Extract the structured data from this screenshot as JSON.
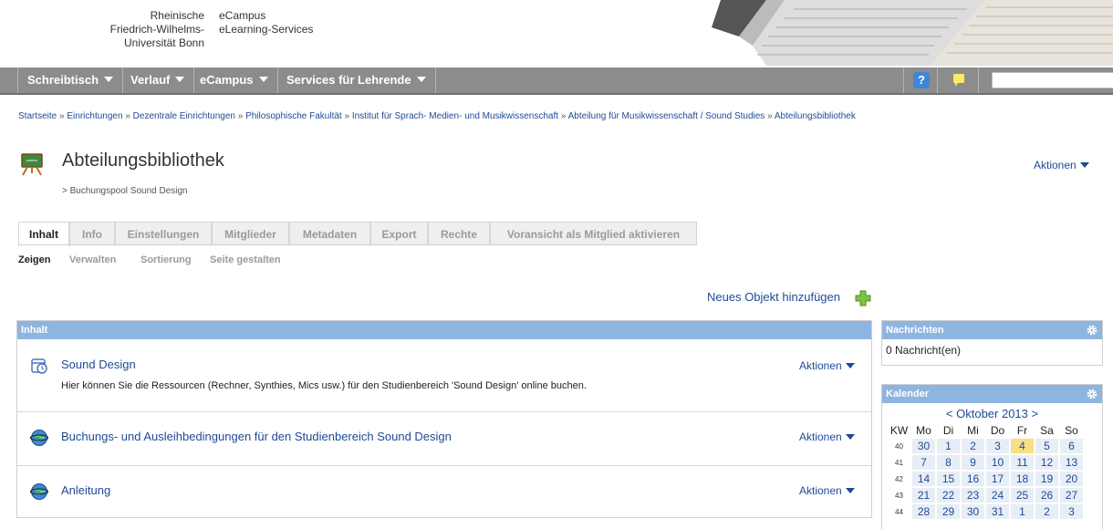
{
  "header": {
    "university_lines": [
      "Rheinische",
      "Friedrich-Wilhelms-",
      "Universität Bonn"
    ],
    "service_lines": [
      "eCampus",
      "eLearning-Services"
    ]
  },
  "mainnav": {
    "items": [
      {
        "label": "Schreibtisch"
      },
      {
        "label": "Verlauf"
      },
      {
        "label": "eCampus"
      },
      {
        "label": "Services für Lehrende"
      }
    ],
    "help_label": "?",
    "search_value": ""
  },
  "breadcrumb": [
    "Startseite",
    "Einrichtungen",
    "Dezentrale Einrichtungen",
    "Philosophische Fakultät",
    "Institut für Sprach- Medien- und Musikwissenschaft",
    "Abteilung für Musikwissenschaft / Sound Studies",
    "Abteilungsbibliothek"
  ],
  "breadcrumb_separator": "»",
  "page": {
    "title": "Abteilungsbibliothek",
    "subtitle": "> Buchungspool Sound Design",
    "actions_label": "Aktionen"
  },
  "tabs": [
    "Inhalt",
    "Info",
    "Einstellungen",
    "Mitglieder",
    "Metadaten",
    "Export",
    "Rechte",
    "Voransicht als Mitglied aktivieren"
  ],
  "subtabs": [
    "Zeigen",
    "Verwalten",
    "Sortierung",
    "Seite gestalten"
  ],
  "add_object_label": "Neues Objekt hinzufügen",
  "content": {
    "header": "Inhalt",
    "items": [
      {
        "title": "Sound Design",
        "description": "Hier können Sie die Ressourcen (Rechner, Synthies, Mics usw.) für den Studienbereich 'Sound Design' online buchen.",
        "actions": "Aktionen",
        "icon": "calendar-clock-icon"
      },
      {
        "title": "Buchungs- und Ausleihbedingungen für den Studienbereich Sound Design",
        "description": "",
        "actions": "Aktionen",
        "icon": "weblink-globe-icon"
      },
      {
        "title": "Anleitung",
        "description": "",
        "actions": "Aktionen",
        "icon": "weblink-globe-icon"
      }
    ]
  },
  "news": {
    "header": "Nachrichten",
    "text": "0 Nachricht(en)"
  },
  "calendar": {
    "header": "Kalender",
    "month_label": "< Oktober 2013 >",
    "weekday_headers": [
      "KW",
      "Mo",
      "Di",
      "Mi",
      "Do",
      "Fr",
      "Sa",
      "So"
    ],
    "weeks": [
      {
        "kw": "40",
        "days": [
          "30",
          "1",
          "2",
          "3",
          "4",
          "5",
          "6"
        ]
      },
      {
        "kw": "41",
        "days": [
          "7",
          "8",
          "9",
          "10",
          "11",
          "12",
          "13"
        ]
      },
      {
        "kw": "42",
        "days": [
          "14",
          "15",
          "16",
          "17",
          "18",
          "19",
          "20"
        ]
      },
      {
        "kw": "43",
        "days": [
          "21",
          "22",
          "23",
          "24",
          "25",
          "26",
          "27"
        ]
      },
      {
        "kw": "44",
        "days": [
          "28",
          "29",
          "30",
          "31",
          "1",
          "2",
          "3"
        ]
      }
    ],
    "today": "4"
  },
  "colors": {
    "nav_bg": "#8c8c8c",
    "block_header": "#8eb5e0",
    "link": "#1f4a94",
    "today_highlight": "#f7df86"
  }
}
